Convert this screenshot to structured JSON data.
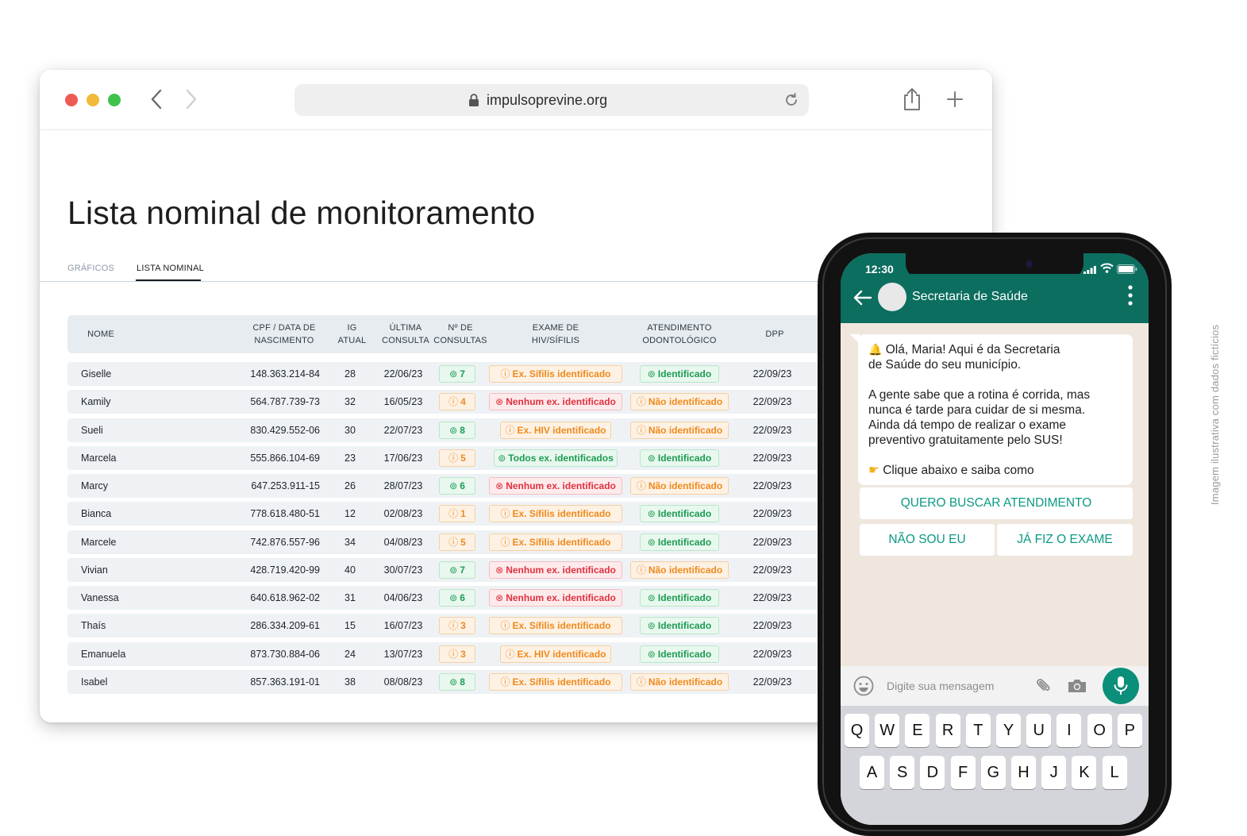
{
  "browser": {
    "url": "impulsoprevine.org"
  },
  "page": {
    "title": "Lista nominal de monitoramento",
    "tabs": [
      "GRÁFICOS",
      "LISTA NOMINAL"
    ]
  },
  "table": {
    "headers": {
      "nome": "NOME",
      "cpf_1": "CPF / DATA DE",
      "cpf_2": "NASCIMENTO",
      "ig_1": "IG",
      "ig_2": "ATUAL",
      "ult_1": "ÚLTIMA",
      "ult_2": "CONSULTA",
      "num_1": "Nº DE",
      "num_2": "CONSULTAS",
      "exame_1": "EXAME DE",
      "exame_2": "HIV/SÍFILIS",
      "odonto_1": "ATENDIMENTO",
      "odonto_2": "ODONTOLÓGICO",
      "dpp": "DPP"
    },
    "rows": [
      {
        "nome": "Giselle",
        "cpf": "148.363.214-84",
        "ig": "28",
        "ultima": "22/06/23",
        "consultas": "7",
        "consultas_status": "ok",
        "exame": "Ex. Sífilis identificado",
        "exame_status": "warn",
        "odonto": "Identificado",
        "odonto_status": "ok",
        "dpp": "22/09/23"
      },
      {
        "nome": "Kamily",
        "cpf": "564.787.739-73",
        "ig": "32",
        "ultima": "16/05/23",
        "consultas": "4",
        "consultas_status": "warn",
        "exame": "Nenhum ex. identificado",
        "exame_status": "bad",
        "odonto": "Não identificado",
        "odonto_status": "warn",
        "dpp": "22/09/23"
      },
      {
        "nome": "Sueli",
        "cpf": "830.429.552-06",
        "ig": "30",
        "ultima": "22/07/23",
        "consultas": "8",
        "consultas_status": "ok",
        "exame": "Ex. HIV identificado",
        "exame_status": "warn",
        "odonto": "Não identificado",
        "odonto_status": "warn",
        "dpp": "22/09/23"
      },
      {
        "nome": "Marcela",
        "cpf": "555.866.104-69",
        "ig": "23",
        "ultima": "17/06/23",
        "consultas": "5",
        "consultas_status": "warn",
        "exame": "Todos ex. identificados",
        "exame_status": "ok",
        "odonto": "Identificado",
        "odonto_status": "ok",
        "dpp": "22/09/23"
      },
      {
        "nome": "Marcy",
        "cpf": "647.253.911-15",
        "ig": "26",
        "ultima": "28/07/23",
        "consultas": "6",
        "consultas_status": "ok",
        "exame": "Nenhum ex. identificado",
        "exame_status": "bad",
        "odonto": "Não identificado",
        "odonto_status": "warn",
        "dpp": "22/09/23"
      },
      {
        "nome": "Bianca",
        "cpf": "778.618.480-51",
        "ig": "12",
        "ultima": "02/08/23",
        "consultas": "1",
        "consultas_status": "warn",
        "exame": "Ex. Sífilis identificado",
        "exame_status": "warn",
        "odonto": "Identificado",
        "odonto_status": "ok",
        "dpp": "22/09/23"
      },
      {
        "nome": "Marcele",
        "cpf": "742.876.557-96",
        "ig": "34",
        "ultima": "04/08/23",
        "consultas": "5",
        "consultas_status": "warn",
        "exame": "Ex. Sífilis identificado",
        "exame_status": "warn",
        "odonto": "Identificado",
        "odonto_status": "ok",
        "dpp": "22/09/23"
      },
      {
        "nome": "Vivian",
        "cpf": "428.719.420-99",
        "ig": "40",
        "ultima": "30/07/23",
        "consultas": "7",
        "consultas_status": "ok",
        "exame": "Nenhum ex. identificado",
        "exame_status": "bad",
        "odonto": "Não identificado",
        "odonto_status": "warn",
        "dpp": "22/09/23"
      },
      {
        "nome": "Vanessa",
        "cpf": "640.618.962-02",
        "ig": "31",
        "ultima": "04/06/23",
        "consultas": "6",
        "consultas_status": "ok",
        "exame": "Nenhum ex. identificado",
        "exame_status": "bad",
        "odonto": "Identificado",
        "odonto_status": "ok",
        "dpp": "22/09/23"
      },
      {
        "nome": "Thaís",
        "cpf": "286.334.209-61",
        "ig": "15",
        "ultima": "16/07/23",
        "consultas": "3",
        "consultas_status": "warn",
        "exame": "Ex. Sífilis identificado",
        "exame_status": "warn",
        "odonto": "Identificado",
        "odonto_status": "ok",
        "dpp": "22/09/23"
      },
      {
        "nome": "Emanuela",
        "cpf": "873.730.884-06",
        "ig": "24",
        "ultima": "13/07/23",
        "consultas": "3",
        "consultas_status": "warn",
        "exame": "Ex. HIV identificado",
        "exame_status": "warn",
        "odonto": "Identificado",
        "odonto_status": "ok",
        "dpp": "22/09/23"
      },
      {
        "nome": "Isabel",
        "cpf": "857.363.191-01",
        "ig": "38",
        "ultima": "08/08/23",
        "consultas": "8",
        "consultas_status": "ok",
        "exame": "Ex. Sífilis identificado",
        "exame_status": "warn",
        "odonto": "Não identificado",
        "odonto_status": "warn",
        "dpp": "22/09/23"
      }
    ]
  },
  "phone": {
    "time": "12:30",
    "contact": "Secretaria de Saúde",
    "message": {
      "line1": "Olá, Maria! Aqui é da Secretaria",
      "line2": "de Saúde do seu município.",
      "line3": "A gente sabe que a rotina é corrida, mas",
      "line4": "nunca é tarde para cuidar de si mesma.",
      "line5": "Ainda dá tempo de realizar o exame",
      "line6": "preventivo gratuitamente pelo SUS!",
      "line7": "Clique abaixo e saiba como"
    },
    "buttons": [
      "QUERO BUSCAR ATENDIMENTO",
      "NÃO SOU EU",
      "JÁ FIZ O EXAME"
    ],
    "input_placeholder": "Digite sua mensagem",
    "keyboard_row1": [
      "Q",
      "W",
      "E",
      "R",
      "T",
      "Y",
      "U",
      "I",
      "O",
      "P"
    ],
    "keyboard_row2": [
      "A",
      "S",
      "D",
      "F",
      "G",
      "H",
      "J",
      "K",
      "L"
    ]
  },
  "disclaimer": "Imagem ilustrativa com dados fictícios",
  "colors": {
    "ok": "#1c9b53",
    "warn": "#ef8a1c",
    "bad": "#e0313f",
    "whatsapp": "#0b6e5f"
  }
}
